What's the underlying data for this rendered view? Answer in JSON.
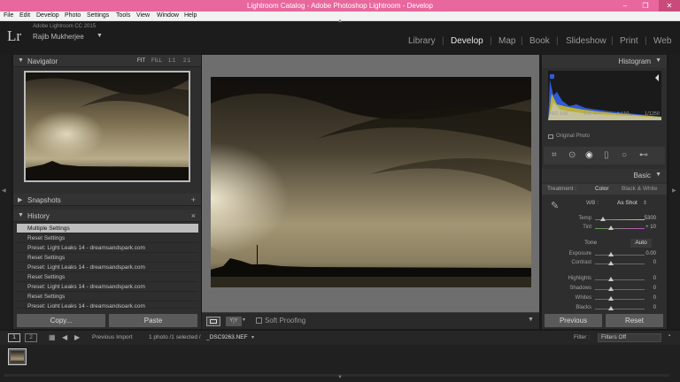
{
  "window": {
    "title": "Lightroom Catalog - Adobe Photoshop Lightroom - Develop",
    "controls": [
      "–",
      "❐",
      "✕"
    ]
  },
  "menu": [
    "File",
    "Edit",
    "Develop",
    "Photo",
    "Settings",
    "Tools",
    "View",
    "Window",
    "Help"
  ],
  "identity": {
    "logo": "Lr",
    "app_version": "Adobe Lightroom CC 2015",
    "user": "Rajib Mukherjee"
  },
  "modules": [
    {
      "label": "Library",
      "active": false
    },
    {
      "label": "Develop",
      "active": true
    },
    {
      "label": "Map",
      "active": false
    },
    {
      "label": "Book",
      "active": false
    },
    {
      "label": "Slideshow",
      "active": false
    },
    {
      "label": "Print",
      "active": false
    },
    {
      "label": "Web",
      "active": false
    }
  ],
  "left": {
    "navigator": {
      "title": "Navigator",
      "options": [
        "FIT",
        "FILL",
        "1:1",
        "2:1"
      ],
      "selected": "FIT"
    },
    "snapshots": {
      "title": "Snapshots",
      "action": "+"
    },
    "history": {
      "title": "History",
      "action": "×",
      "items": [
        "Multiple Settings",
        "Reset Settings",
        "Preset: Light Leaks 14 - dreamsandspark.com",
        "Reset Settings",
        "Preset: Light Leaks 14 - dreamsandspark.com",
        "Reset Settings",
        "Preset: Light Leaks 14 - dreamsandspark.com",
        "Reset Settings",
        "Preset: Light Leaks 14 - dreamsandspark.com"
      ],
      "selected_index": 0
    },
    "buttons": {
      "copy": "Copy...",
      "paste": "Paste"
    }
  },
  "toolbar": {
    "soft_proofing": "Soft Proofing",
    "compare_label": "Y|Y"
  },
  "right": {
    "histogram": {
      "title": "Histogram",
      "info": [
        "ISO 100",
        "105 mm",
        "ƒ / 10",
        "1/1250"
      ],
      "original_photo": "Original Photo"
    },
    "basic": {
      "title": "Basic",
      "treatment_label": "Treatment :",
      "treatment_options": [
        "Color",
        "Black & White"
      ],
      "treatment_selected": "Color",
      "wb_label": "WB :",
      "wb_value": "As Shot",
      "temp": {
        "label": "Temp",
        "value": "5300"
      },
      "tint": {
        "label": "Tint",
        "value": "+ 10"
      },
      "tone_label": "Tone",
      "auto_label": "Auto",
      "exposure": {
        "label": "Exposure",
        "value": "0.00"
      },
      "contrast": {
        "label": "Contrast",
        "value": "0"
      },
      "highlights": {
        "label": "Highlights",
        "value": "0"
      },
      "shadows": {
        "label": "Shadows",
        "value": "0"
      },
      "whites": {
        "label": "Whites",
        "value": "0"
      },
      "blacks": {
        "label": "Blacks",
        "value": "0"
      }
    },
    "buttons": {
      "previous": "Previous",
      "reset": "Reset"
    }
  },
  "filmbar": {
    "pages": [
      "1",
      "2"
    ],
    "source": "Previous Import",
    "status": "1 photo /1 selected /",
    "filename": "_DSC9263.NEF",
    "filter_label": "Filter :",
    "filter_value": "Filters Off"
  },
  "colors": {
    "titlebar": "#e8679c",
    "panel": "#2e2e2e",
    "center_bg": "#6e6e6e"
  }
}
